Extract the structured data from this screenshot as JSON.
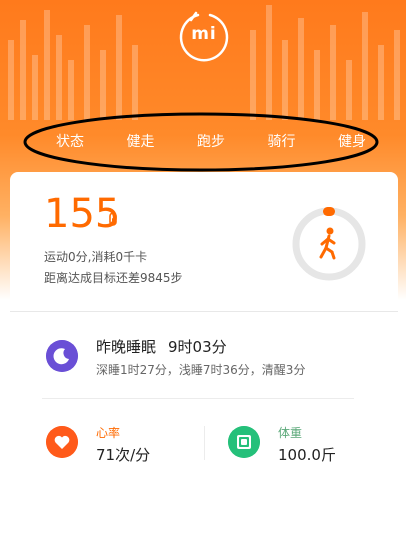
{
  "header": {
    "logo": "mi",
    "tabs": [
      {
        "label": "状态"
      },
      {
        "label": "健走"
      },
      {
        "label": "跑步"
      },
      {
        "label": "骑行"
      },
      {
        "label": "健身"
      }
    ]
  },
  "summary": {
    "steps": "155",
    "activity": "运动0分,消耗0千卡",
    "goal_remaining": "距离达成目标还差9845步",
    "ring_icon": "walking-person-icon"
  },
  "sleep": {
    "title": "昨晚睡眠",
    "duration": "9时03分",
    "detail": "深睡1时27分，浅睡7时36分，清醒3分",
    "icon": "moon-icon"
  },
  "heart_rate": {
    "label": "心率",
    "value": "71次/分",
    "icon": "heart-icon"
  },
  "weight": {
    "label": "体重",
    "value": "100.0斤",
    "icon": "scale-icon"
  },
  "colors": {
    "accent": "#ff6a00",
    "hero_top": "#ff7a1c",
    "sleep": "#6a4fd6",
    "heart": "#ff5a1a",
    "weight": "#25c07a"
  }
}
